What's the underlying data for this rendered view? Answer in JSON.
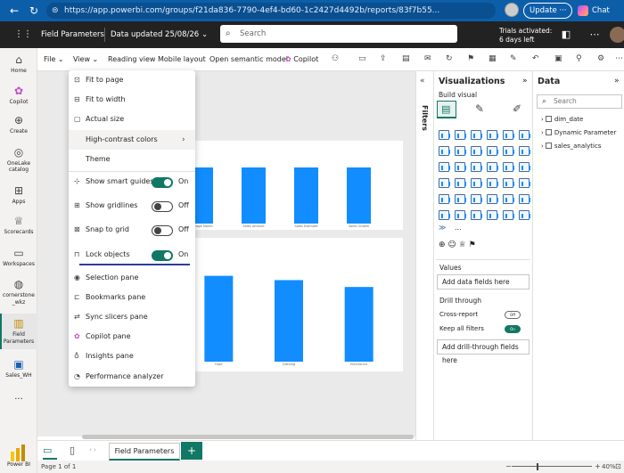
{
  "browser": {
    "url": "https://app.powerbi.com/groups/f21da836-7790-4ef4-bd60-1c2427d4492b/reports/83f7b55...",
    "update_label": "Update",
    "chat_label": "Chat"
  },
  "header": {
    "report_name": "Field Parameters",
    "data_updated": "Data updated 25/08/26",
    "search_placeholder": "Search",
    "trial_line1": "Trials activated:",
    "trial_line2": "6 days left"
  },
  "left_nav": [
    {
      "label": "Home",
      "icon": "home-icon"
    },
    {
      "label": "Copilot",
      "icon": "copilot-icon"
    },
    {
      "label": "Create",
      "icon": "plus-icon"
    },
    {
      "label": "OneLake catalog",
      "icon": "onelake-icon"
    },
    {
      "label": "Apps",
      "icon": "apps-icon"
    },
    {
      "label": "Scorecards",
      "icon": "trophy-icon"
    },
    {
      "label": "Workspaces",
      "icon": "workspaces-icon"
    },
    {
      "label": "cornerstone _wkz",
      "icon": "workspace-icon"
    },
    {
      "label": "Field Parameters",
      "icon": "report-icon"
    },
    {
      "label": "Sales_WH",
      "icon": "warehouse-icon"
    },
    {
      "label": "...",
      "icon": "more-icon"
    }
  ],
  "brand_label": "Power BI",
  "ribbon": {
    "file": "File",
    "view": "View",
    "reading_view": "Reading view",
    "mobile_layout": "Mobile layout",
    "open_semantic_model": "Open semantic model",
    "copilot": "Copilot"
  },
  "view_menu": {
    "fit_to_page": "Fit to page",
    "fit_to_width": "Fit to width",
    "actual_size": "Actual size",
    "high_contrast": "High-contrast colors",
    "theme": "Theme",
    "smart_guides": "Show smart guides",
    "smart_guides_state": "On",
    "gridlines": "Show gridlines",
    "gridlines_state": "Off",
    "snap": "Snap to grid",
    "snap_state": "Off",
    "lock": "Lock objects",
    "lock_state": "On",
    "selection_pane": "Selection pane",
    "bookmarks_pane": "Bookmarks pane",
    "sync_slicers": "Sync slicers pane",
    "copilot_pane": "Copilot pane",
    "insights_pane": "Insights pane",
    "performance_analyzer": "Performance analyzer"
  },
  "chart_data": [
    {
      "type": "bar",
      "categories": [
        "Average Month",
        "Sales Amount",
        "Sales Estimate",
        "Sales Growth"
      ],
      "values": [
        0.9,
        0.9,
        0.9,
        0.9
      ],
      "ylim": [
        0,
        1
      ]
    },
    {
      "type": "bar",
      "categories": [
        "Food",
        "Clothing",
        "Electronics"
      ],
      "values": [
        1.0,
        0.95,
        0.87
      ],
      "ylim": [
        0,
        1.1
      ]
    }
  ],
  "filters_label": "Filters",
  "visualizations": {
    "title": "Visualizations",
    "build_visual": "Build visual",
    "values_label": "Values",
    "add_data_fields": "Add data fields here",
    "drill_through": "Drill through",
    "cross_report": "Cross-report",
    "cross_report_state": "Off",
    "keep_all_filters": "Keep all filters",
    "keep_all_filters_state": "On",
    "add_drill_fields": "Add drill-through fields here",
    "more": "..."
  },
  "data_pane": {
    "title": "Data",
    "search_placeholder": "Search",
    "tables": [
      "dim_date",
      "Dynamic Parameter",
      "sales_analytics"
    ]
  },
  "tabs": {
    "page_tab": "Field Parameters"
  },
  "status": {
    "page_info": "Page 1 of 1",
    "zoom": "40%"
  },
  "colors": {
    "accent": "#117865",
    "bar": "#118dff",
    "header": "#222222",
    "browser": "#0c5ea8"
  }
}
